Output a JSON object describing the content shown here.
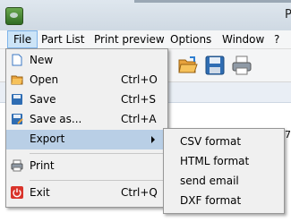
{
  "window": {
    "title": "P"
  },
  "menubar": {
    "items": [
      {
        "label": "File"
      },
      {
        "label": "Part List"
      },
      {
        "label": "Print preview"
      },
      {
        "label": "Options"
      },
      {
        "label": "Window"
      },
      {
        "label": "?"
      }
    ]
  },
  "file_menu": {
    "items": [
      {
        "label": "New",
        "shortcut": "",
        "icon": "new-document-icon"
      },
      {
        "label": "Open",
        "shortcut": "Ctrl+O",
        "icon": "open-folder-icon"
      },
      {
        "label": "Save",
        "shortcut": "Ctrl+S",
        "icon": "save-icon"
      },
      {
        "label": "Save as...",
        "shortcut": "Ctrl+A",
        "icon": "save-as-icon"
      },
      {
        "label": "Export",
        "shortcut": "",
        "icon": ""
      },
      {
        "label": "Print",
        "shortcut": "",
        "icon": "print-icon"
      },
      {
        "label": "Exit",
        "shortcut": "Ctrl+Q",
        "icon": "power-icon"
      }
    ]
  },
  "export_menu": {
    "items": [
      {
        "label": "CSV format"
      },
      {
        "label": "HTML format"
      },
      {
        "label": "send email"
      },
      {
        "label": "DXF format"
      }
    ]
  },
  "content": {
    "partial_number": "7"
  },
  "colors": {
    "highlight": "#b9cfe6",
    "menubar_active": "#cce4f7",
    "exit_red": "#d9342b"
  }
}
